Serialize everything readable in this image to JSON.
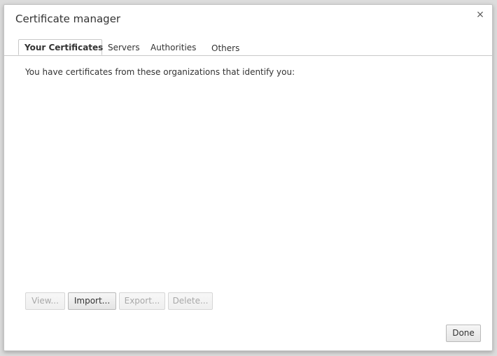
{
  "dialog": {
    "title": "Certificate manager",
    "close_symbol": "×"
  },
  "tabs": [
    {
      "label": "Your Certificates",
      "active": true
    },
    {
      "label": "Servers",
      "active": false
    },
    {
      "label": "Authorities",
      "active": false
    },
    {
      "label": "Others",
      "active": false
    }
  ],
  "content": {
    "description": "You have certificates from these organizations that identify you:"
  },
  "buttons": {
    "view": "View...",
    "import": "Import...",
    "export": "Export...",
    "delete": "Delete..."
  },
  "footer": {
    "done": "Done"
  }
}
